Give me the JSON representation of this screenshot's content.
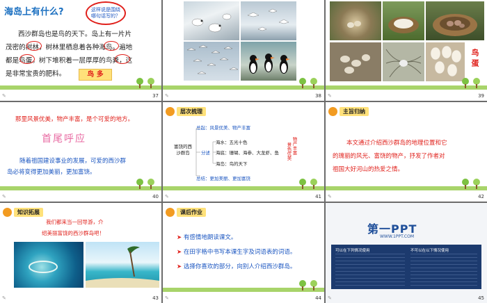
{
  "slide37": {
    "title": "海岛上有什么?",
    "bubble": "这样说是围绕哪句话写的？",
    "line1": "西沙群岛也是鸟的天下。岛上有一片片",
    "line2": "茂密的树林，树林里栖息着各种海鸟。遍地",
    "line3": "都是鸟蛋。树下堆积着一层厚厚的鸟粪，这",
    "line4": "是非常宝贵的肥料。",
    "tag": "鸟 多",
    "num": "37"
  },
  "slide38": {
    "num": "38"
  },
  "slide39": {
    "tag": "鸟 蛋",
    "num": "39"
  },
  "slide40": {
    "line1": "那里风景优美，物产丰富，是个可爱的地方。",
    "heading": "首尾呼应",
    "line2": "随着祖国建设事业的发展，可爱的西沙群",
    "line3": "岛必将变得更加美丽，更加富饶。",
    "num": "40"
  },
  "slide41": {
    "tag": "层次梳理",
    "summary_top": "总起：风景优美、物产丰富",
    "left": "富饶的西沙群岛",
    "split": "分述",
    "items": [
      "海水：五光十色",
      "海底：珊瑚、海参、大龙虾、鱼",
      "海岛：鸟的天下"
    ],
    "side": "物产丰富",
    "side2": "景色优美",
    "summary_bottom": "总结：更加美丽、更加富饶",
    "num": "41"
  },
  "slide42": {
    "tag": "主旨归纳",
    "line1": "本文通过介绍西沙群岛的地理位置和它",
    "line2": "的瑰丽的风光、富饶的物产，抒发了作者对",
    "line3": "祖国大好河山的热爱之情。",
    "num": "42"
  },
  "slide43": {
    "tag": "知识拓展",
    "line1": "我们都来当一回导游，介",
    "line2": "绍美丽富饶的西沙群岛吧！",
    "num": "43"
  },
  "slide44": {
    "tag": "课后作业",
    "tasks": [
      "有感情地朗读课文。",
      "在田字格中书写本课生字及词语表的词语。",
      "选择你喜欢的部分，向别人介绍西沙群岛。"
    ],
    "num": "44"
  },
  "slide45": {
    "logo": "第一PPT",
    "url": "WWW.1PPT.COM",
    "can_use": "可以在下列情况使用",
    "cannot_use": "不可以在以下情况使用",
    "num": "45"
  },
  "colors": {
    "green": "#7cc242",
    "red": "#e0201b",
    "blue": "#1f4f9a"
  }
}
